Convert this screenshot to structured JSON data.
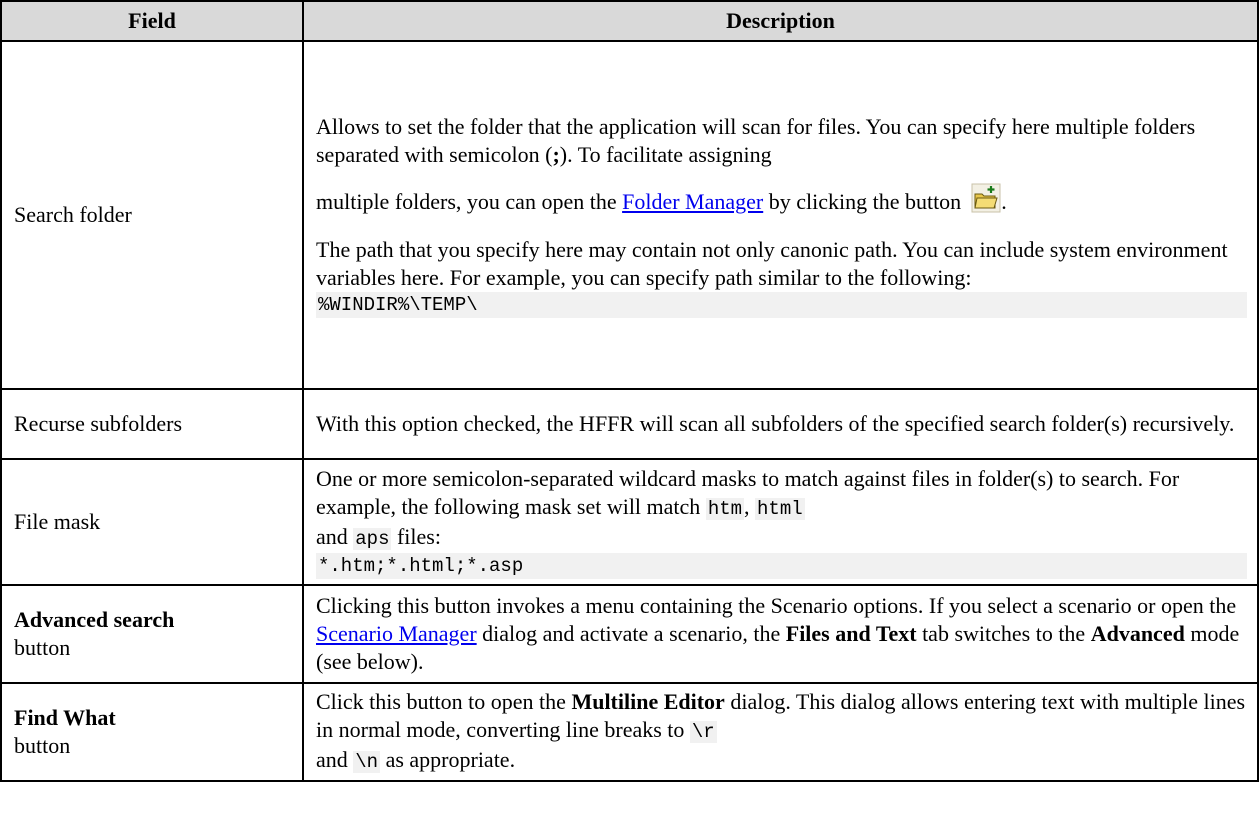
{
  "header": {
    "field": "Field",
    "description": "Description"
  },
  "rows": [
    {
      "field": "Search folder",
      "p1_a": "Allows to set the folder that the application will scan for files. You can specify here multiple folders separated with semicolon (",
      "p1_sep": ";",
      "p1_b": "). To facilitate assigning",
      "p1_c": "multiple folders, you can open the ",
      "p1_link": "Folder Manager",
      "p1_d": " by clicking the button",
      "p1_e": ".",
      "p2": "The path that you specify here may contain not only canonic path. You can include system environment variables here. For example, you can specify path similar to the following:",
      "code": "%WINDIR%\\TEMP\\",
      "icon": "folder-add-icon"
    },
    {
      "field": "Recurse subfolders",
      "desc": "With this option checked, the HFFR will scan all subfolders of the specified search folder(s) recursively."
    },
    {
      "field": "File mask",
      "desc_a": "One or more semicolon-separated wildcard masks to match against files in folder(s) to search. For example, the following mask set will match ",
      "c1": "htm",
      "sep": ", ",
      "c2": "html",
      "desc_b": "and ",
      "c3": "aps",
      "desc_c": " files:",
      "code": "*.htm;*.html;*.asp"
    },
    {
      "field_bold": "Advanced search",
      "field_sub": "button",
      "desc_a": "Clicking this button invokes a menu containing the Scenario options. If you select a scenario or open the ",
      "link": "Scenario Manager",
      "desc_b": " dialog and activate a scenario, the ",
      "b1": "Files and Text",
      "desc_c": " tab switches to the ",
      "b2": "Advanced",
      "desc_d": " mode (see below)."
    },
    {
      "field_bold": "Find What",
      "field_sub": "button",
      "desc_a": "Click this button to open the ",
      "b1": "Multiline Editor",
      "desc_b": " dialog. This dialog allows entering text with multiple lines in normal mode, converting line breaks to ",
      "c1": "\\r",
      "desc_c": "and ",
      "c2": "\\n",
      "desc_d": " as appropriate."
    }
  ],
  "colors": {
    "header_bg": "#d9d9d9",
    "code_bg": "#f1f1f1",
    "link": "#0000ee"
  }
}
